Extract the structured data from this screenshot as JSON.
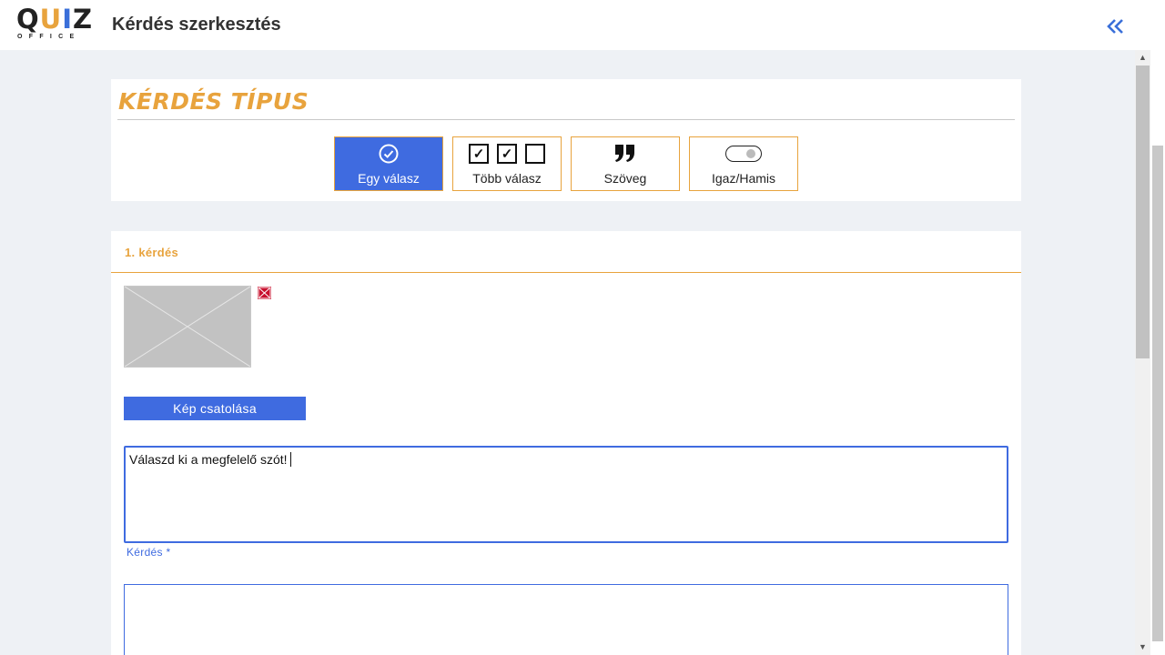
{
  "header": {
    "logo_main": "QUIZ",
    "logo_sub": "OFFICE",
    "title": "Kérdés szerkesztés",
    "collapse_icon": "double-chevron-left-icon"
  },
  "question_type": {
    "heading": "KÉRDÉS TÍPUS",
    "options": [
      {
        "label": "Egy válasz",
        "icon": "check-circle-icon",
        "active": true
      },
      {
        "label": "Több válasz",
        "icon": "checkboxes-icon",
        "active": false
      },
      {
        "label": "Szöveg",
        "icon": "quote-icon",
        "active": false
      },
      {
        "label": "Igaz/Hamis",
        "icon": "toggle-icon",
        "active": false
      }
    ]
  },
  "question": {
    "title": "1. kérdés",
    "attach_label": "Kép csatolása",
    "text_value": "Válaszd ki a megfelelő szót!",
    "field_label": "Kérdés *"
  },
  "colors": {
    "accent_orange": "#e8a33d",
    "primary_blue": "#3f6be0",
    "remove_red": "#c8102e"
  }
}
